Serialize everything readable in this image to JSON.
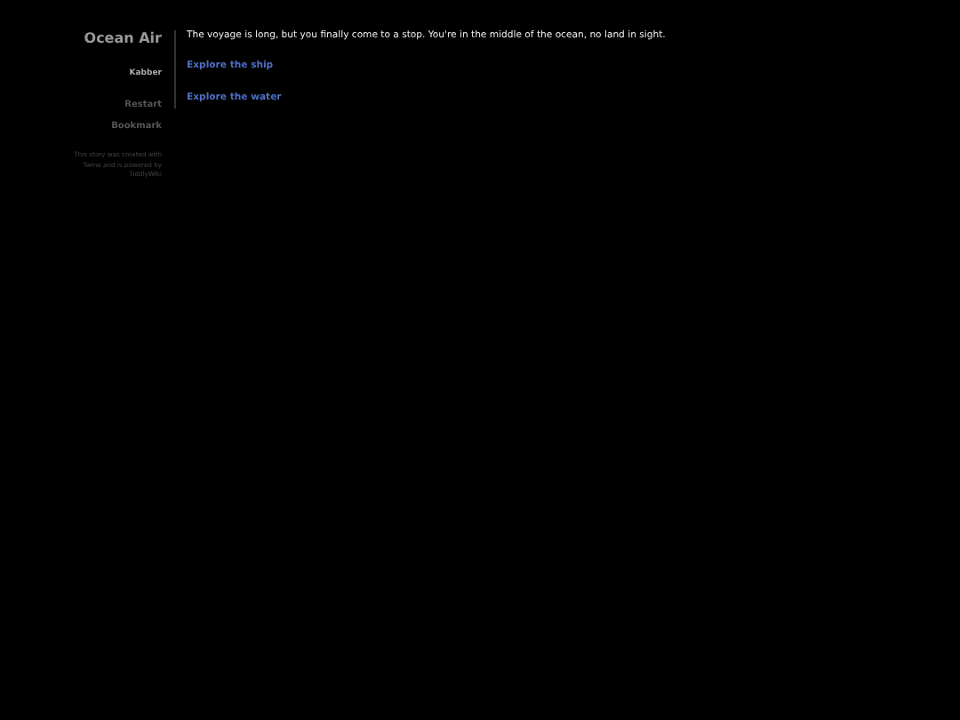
{
  "sidebar": {
    "title": "Ocean Air",
    "author": "Kabber",
    "menu": [
      {
        "label": "Restart"
      },
      {
        "label": "Bookmark"
      }
    ],
    "credits": "This story was created with Twine and is powered by TiddlyWiki"
  },
  "passage": {
    "text": "The voyage is long, but you finally come to a stop. You're in the middle of the ocean, no land in sight.",
    "links": [
      {
        "label": "Explore the ship"
      },
      {
        "label": "Explore the water"
      }
    ]
  }
}
